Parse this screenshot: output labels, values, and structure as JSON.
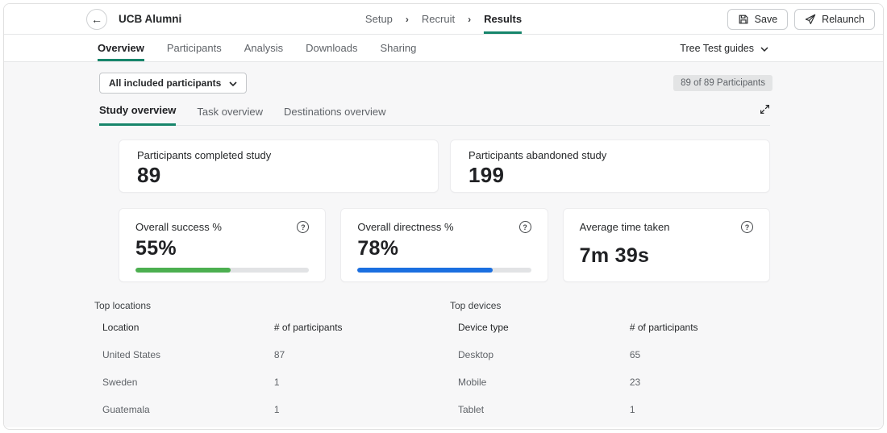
{
  "header": {
    "title": "UCB Alumni",
    "back_icon": "arrow-left",
    "breadcrumb": [
      {
        "label": "Setup",
        "active": false
      },
      {
        "label": "Recruit",
        "active": false
      },
      {
        "label": "Results",
        "active": true
      }
    ],
    "breadcrumb_separator": "›",
    "save_label": "Save",
    "relaunch_label": "Relaunch"
  },
  "tabs": {
    "items": [
      {
        "label": "Overview",
        "active": true
      },
      {
        "label": "Participants",
        "active": false
      },
      {
        "label": "Analysis",
        "active": false
      },
      {
        "label": "Downloads",
        "active": false
      },
      {
        "label": "Sharing",
        "active": false
      }
    ],
    "guides_label": "Tree Test guides"
  },
  "filter": {
    "participants_dropdown": "All included participants",
    "count_badge": "89 of 89 Participants"
  },
  "subtabs": [
    {
      "label": "Study overview",
      "active": true
    },
    {
      "label": "Task overview",
      "active": false
    },
    {
      "label": "Destinations overview",
      "active": false
    }
  ],
  "summary_cards": [
    {
      "label": "Participants completed study",
      "value": "89"
    },
    {
      "label": "Participants abandoned study",
      "value": "199"
    }
  ],
  "metric_cards": [
    {
      "label": "Overall success %",
      "value": "55%",
      "progress": 55,
      "info_icon": "?"
    },
    {
      "label": "Overall directness %",
      "value": "78%",
      "progress": 78,
      "info_icon": "?"
    },
    {
      "label": "Average time taken",
      "value": "7m 39s",
      "info_icon": "?"
    }
  ],
  "tables": [
    {
      "title": "Top locations",
      "columns": [
        "Location",
        "# of participants"
      ],
      "rows": [
        [
          "United States",
          "87"
        ],
        [
          "Sweden",
          "1"
        ],
        [
          "Guatemala",
          "1"
        ]
      ]
    },
    {
      "title": "Top devices",
      "columns": [
        "Device type",
        "# of participants"
      ],
      "rows": [
        [
          "Desktop",
          "65"
        ],
        [
          "Mobile",
          "23"
        ],
        [
          "Tablet",
          "1"
        ]
      ]
    }
  ],
  "colors": {
    "accent_green": "#17856b",
    "progress_green": "#4caf50",
    "progress_blue": "#1b6fe0",
    "content_bg": "#f7f7f8"
  }
}
